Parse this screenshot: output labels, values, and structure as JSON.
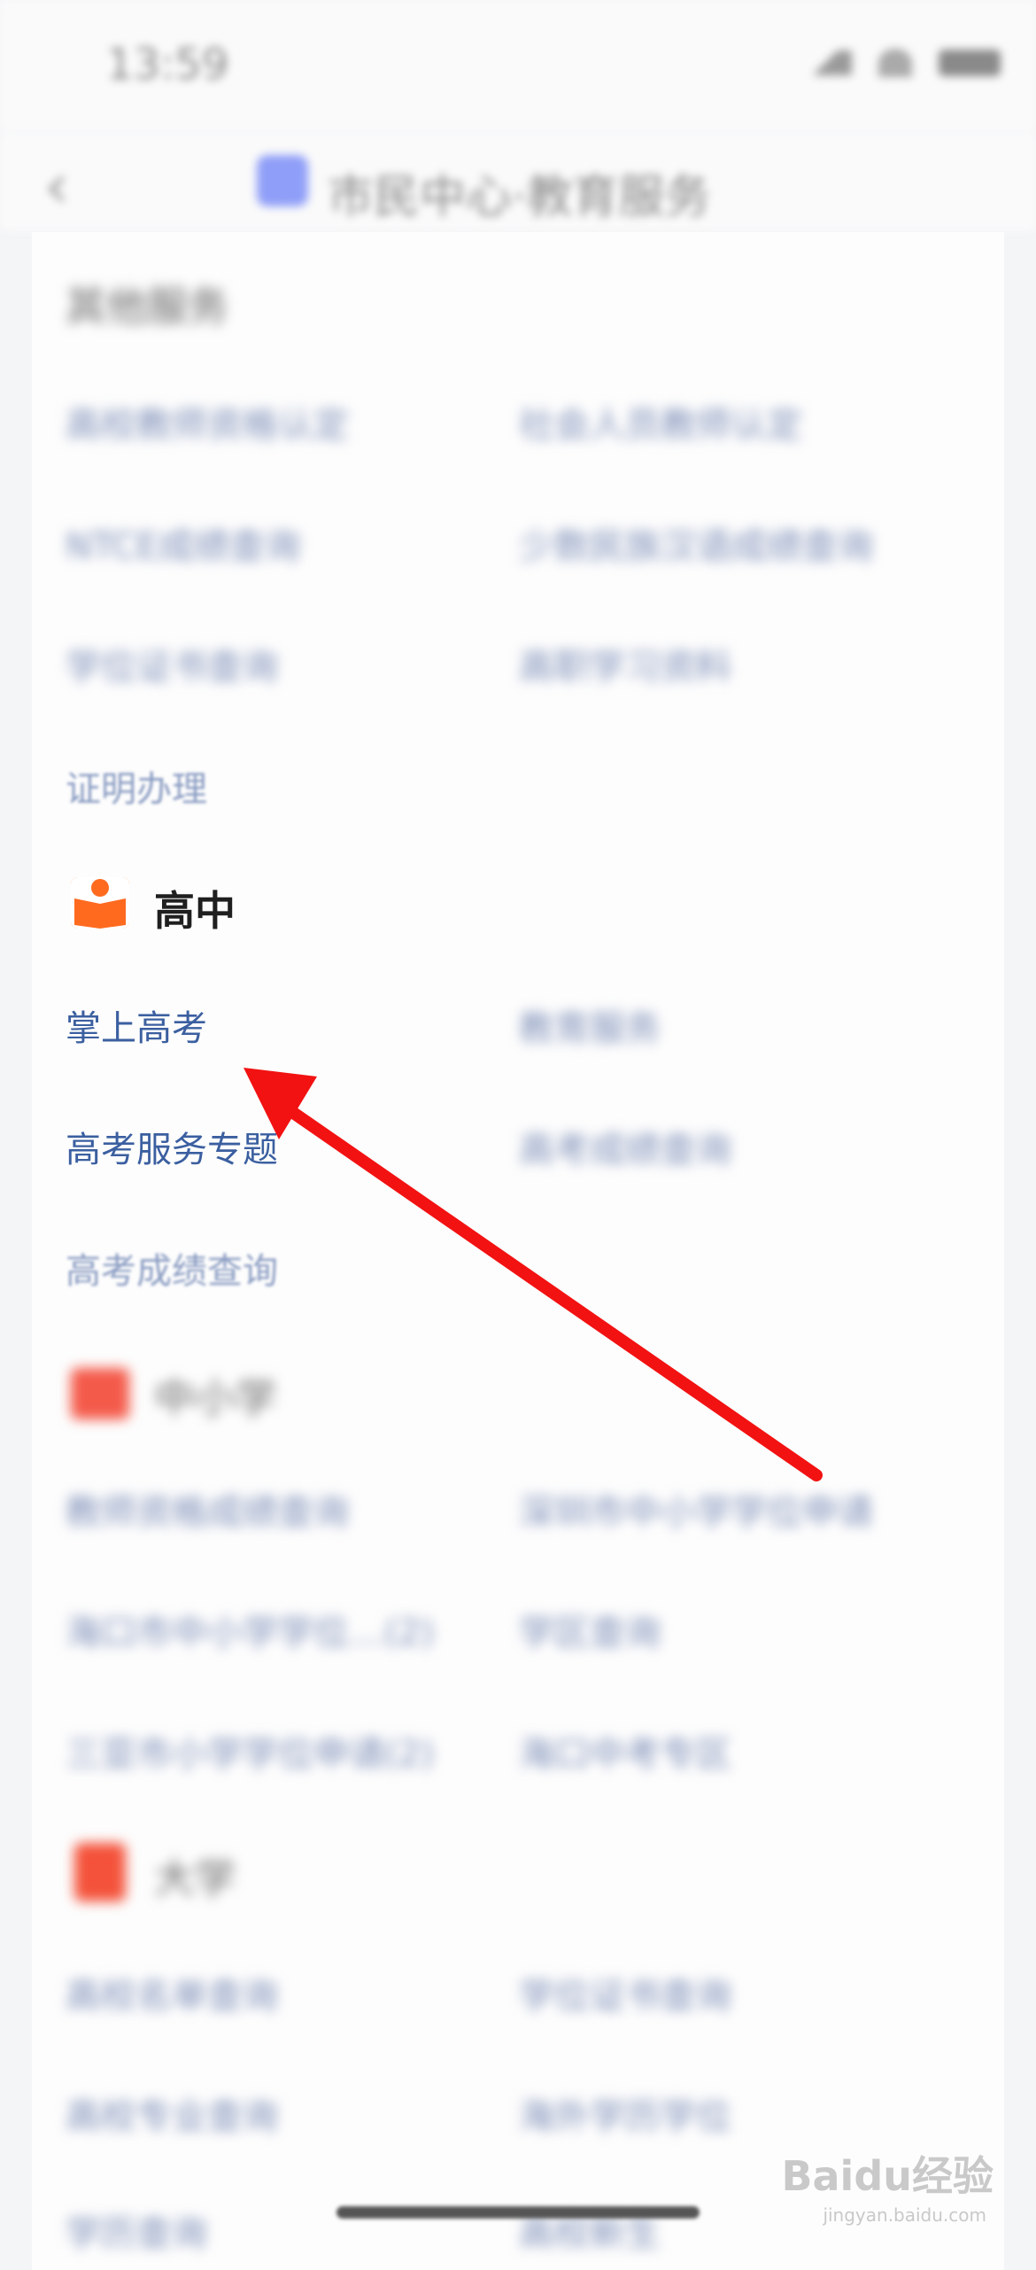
{
  "status_bar": {
    "time": "13:59"
  },
  "nav": {
    "title": "市民中心·教育服务"
  },
  "sections": {
    "other": {
      "title": "其他服务",
      "items": [
        "高校教师资格认定",
        "社会人员教师认定",
        "NTCE成绩查询",
        "少数民族汉语成绩查询",
        "学位证书查询",
        "高职学习资料"
      ]
    },
    "cert": {
      "label": "证明办理"
    },
    "high_school": {
      "title": "高中",
      "items": [
        "掌上高考",
        "教育服务",
        "高考服务专题",
        "高考成绩查询",
        "高考成绩查询"
      ]
    },
    "primary": {
      "title": "中小学",
      "items": [
        "教师资格成绩查询",
        "深圳市中小学学位申请",
        "海口市中小学学位…(2)",
        "学区查询",
        "三亚市小学学位申请(2)",
        "海口中考专区"
      ]
    },
    "university": {
      "title": "大学",
      "items": [
        "高校名单查询",
        "学位证书查询",
        "高校专业查询",
        "海外学历学位",
        "学历查询",
        "高校新生"
      ]
    }
  },
  "watermark": {
    "brand": "Baidu经验",
    "url": "jingyan.baidu.com"
  },
  "colors": {
    "accent_orange": "#ff6a1f",
    "link_blue": "#3b5fa0",
    "arrow_red": "#f21212"
  }
}
